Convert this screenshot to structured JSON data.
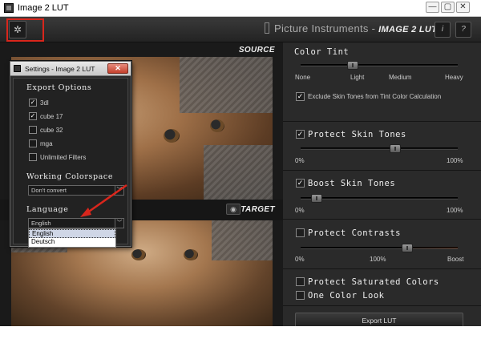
{
  "window": {
    "title": "Image 2 LUT",
    "buttons": [
      "—",
      "▢",
      "✕"
    ]
  },
  "toolbar": {
    "settings_icon": "gear-icon",
    "brand": "Picture Instruments -",
    "product": "IMAGE 2 LUT",
    "info_label": "i",
    "help_label": "?"
  },
  "viewer": {
    "source_label": "SOURCE",
    "target_label": "TARGET",
    "eye_icon": "eye-icon"
  },
  "controls": {
    "color_tint": {
      "title": "Color Tint",
      "labels": [
        "None",
        "Light",
        "Medium",
        "Heavy"
      ],
      "value_fraction": 0.33,
      "exclude_label": "Exclude Skin Tones from Tint Color Calculation",
      "exclude_checked": true
    },
    "protect_skin": {
      "title": "Protect Skin Tones",
      "checked": true,
      "min_label": "0%",
      "max_label": "100%",
      "value_fraction": 0.6
    },
    "boost_skin": {
      "title": "Boost Skin Tones",
      "checked": true,
      "min_label": "0%",
      "max_label": "100%",
      "value_fraction": 0.1
    },
    "protect_contrasts": {
      "title": "Protect Contrasts",
      "checked": false,
      "min_label": "0%",
      "mid_label": "100%",
      "max_label": "Boost",
      "value_fraction": 0.68
    },
    "protect_saturated": {
      "title": "Protect Saturated Colors",
      "checked": false
    },
    "one_color_look": {
      "title": "One Color Look",
      "checked": false
    },
    "export_label": "Export LUT"
  },
  "settings_dialog": {
    "title": "Settings - Image 2 LUT",
    "close_label": "✕",
    "export_options_heading": "Export Options",
    "export_options": [
      {
        "label": "3dl",
        "checked": true
      },
      {
        "label": "cube 17",
        "checked": true
      },
      {
        "label": "cube 32",
        "checked": false
      },
      {
        "label": "mga",
        "checked": false
      },
      {
        "label": "Unlimited Filters",
        "checked": false
      }
    ],
    "colorspace_heading": "Working Colorspace",
    "colorspace_value": "Don't convert",
    "language_heading": "Language",
    "language_value": "English",
    "language_options": [
      "English",
      "Deutsch"
    ]
  },
  "colors": {
    "highlight": "#d9261c",
    "panel_bg": "#2a2a2a",
    "image_bg": "#1a1a1a"
  }
}
